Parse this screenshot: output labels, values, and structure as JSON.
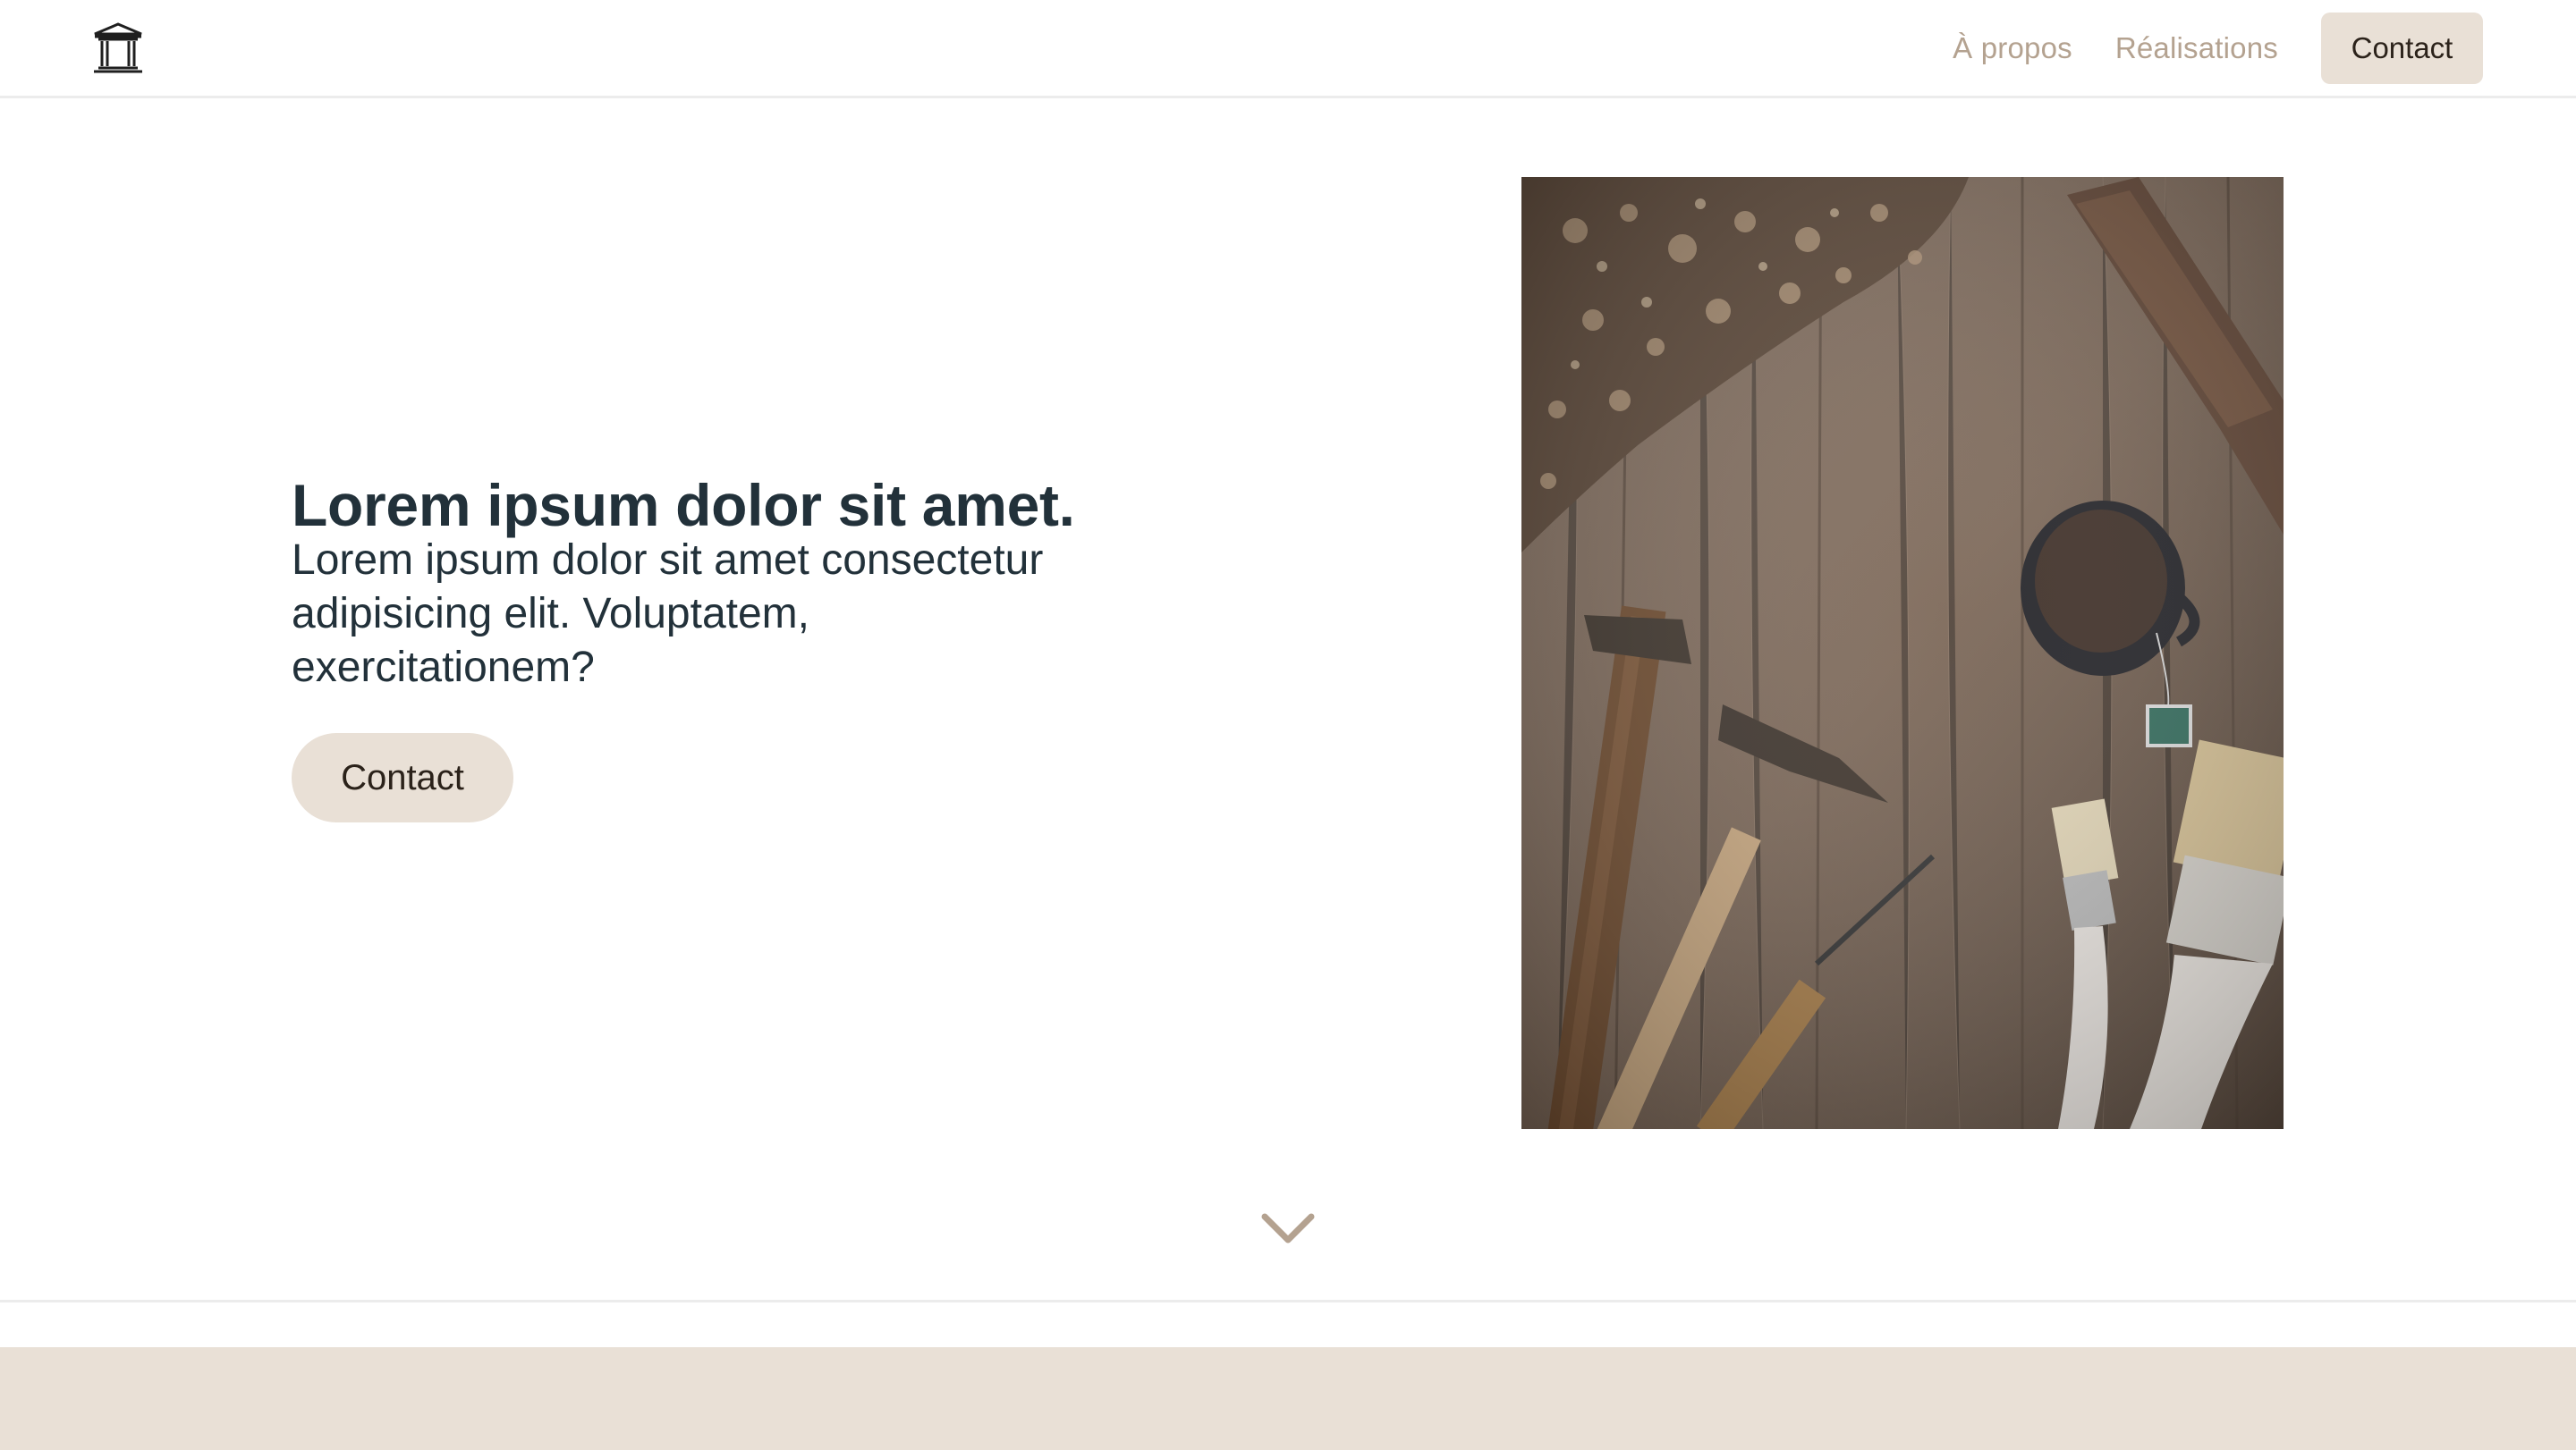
{
  "header": {
    "logo_icon": "temple-icon",
    "nav": [
      {
        "label": "À propos"
      },
      {
        "label": "Réalisations"
      }
    ],
    "contact_label": "Contact"
  },
  "hero": {
    "title": "Lorem ipsum dolor sit amet.",
    "subtitle": "Lorem ipsum dolor sit amet consectetur adipisicing elit. Voluptatem, exercitationem?",
    "button_label": "Contact",
    "image": "photo-carpentry-tools"
  },
  "scroll_icon": "chevron-down-icon",
  "colors": {
    "accent": "#e9e0d6",
    "nav_text": "#b4a290",
    "heading": "#22313a",
    "button_text": "#2b221a"
  }
}
